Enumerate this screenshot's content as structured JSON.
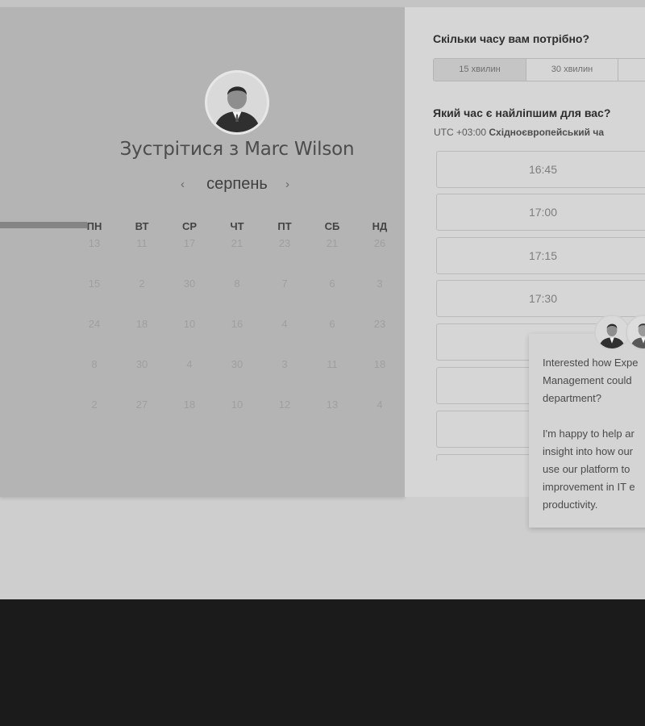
{
  "meeting": {
    "title": "Зустрітися з Marc Wilson",
    "month": "серпень",
    "prev_arrow": "‹",
    "next_arrow": "›",
    "progress": 1.0
  },
  "calendar": {
    "weekdays": [
      "ПН",
      "ВТ",
      "СР",
      "ЧТ",
      "ПТ",
      "СБ",
      "НД"
    ],
    "weeks": [
      [
        "13",
        "11",
        "17",
        "21",
        "23",
        "21",
        "26"
      ],
      [
        "15",
        "2",
        "30",
        "8",
        "7",
        "6",
        "3"
      ],
      [
        "24",
        "18",
        "10",
        "16",
        "4",
        "6",
        "23"
      ],
      [
        "8",
        "30",
        "4",
        "30",
        "3",
        "11",
        "18"
      ],
      [
        "2",
        "27",
        "18",
        "10",
        "12",
        "13",
        "4"
      ]
    ]
  },
  "booking": {
    "duration_question": "Скільки часу вам потрібно?",
    "durations": [
      {
        "label": "15 хвилин",
        "active": true
      },
      {
        "label": "30 хвилин",
        "active": false
      },
      {
        "label": "",
        "active": false
      }
    ],
    "time_question": "Який час є найліпшим для вас?",
    "tz_prefix": "UTC +03:00",
    "tz_name": "Східноєвропейський ча",
    "slots": [
      "16:45",
      "17:00",
      "17:15",
      "17:30",
      "",
      "",
      "",
      ""
    ]
  },
  "chat": {
    "message": "Interested how Expe\nManagement could\ndepartment?\n\nI'm happy to help ar\ninsight into how our\nuse our platform to\nimprovement in IT e\nproductivity."
  },
  "colors": {
    "left_panel": "#b4b4b4",
    "right_panel": "#d6d6d6",
    "footer": "#1b1b1b"
  }
}
